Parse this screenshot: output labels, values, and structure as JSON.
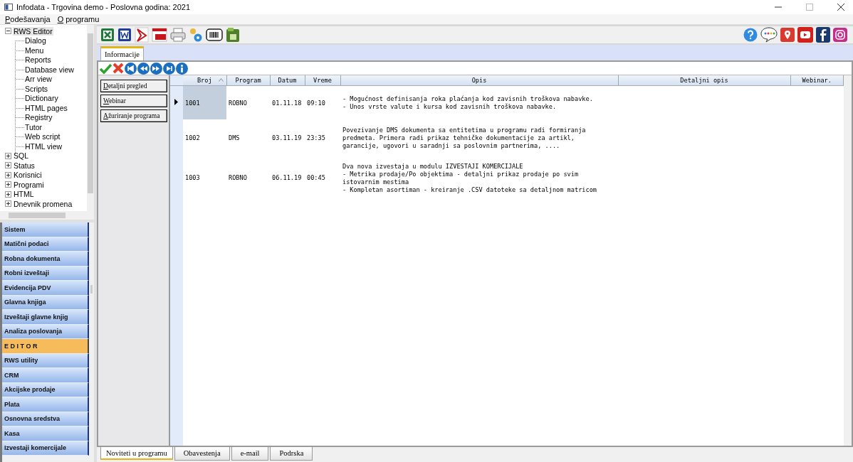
{
  "window": {
    "title": "Infodata -  Trgovina demo - Poslovna godina: 2021"
  },
  "menu": [
    "Podešavanja",
    "O programu"
  ],
  "tree": [
    {
      "label": "RWS Editor",
      "expanded": true,
      "selected": true,
      "children": [
        {
          "label": "Dialog",
          "selected": false
        },
        {
          "label": "Menu",
          "selected": false
        },
        {
          "label": "Reports",
          "selected": false
        },
        {
          "label": "Database view",
          "selected": false
        },
        {
          "label": "Arr view",
          "selected": false
        },
        {
          "label": "Scripts",
          "selected": false
        },
        {
          "label": "Dictionary",
          "selected": false
        },
        {
          "label": "HTML pages",
          "selected": false
        },
        {
          "label": "Registry",
          "selected": false
        },
        {
          "label": "Tutor",
          "selected": false
        },
        {
          "label": "Web script",
          "selected": false
        },
        {
          "label": "HTML view",
          "selected": false
        }
      ]
    },
    {
      "label": "SQL",
      "expanded": false,
      "selected": false
    },
    {
      "label": "Status",
      "expanded": false,
      "selected": false
    },
    {
      "label": "Korisnici",
      "expanded": false,
      "selected": false
    },
    {
      "label": "Programi",
      "expanded": false,
      "selected": false
    },
    {
      "label": "HTML",
      "expanded": false,
      "selected": false
    },
    {
      "label": "Dnevnik promena",
      "expanded": false,
      "selected": false
    }
  ],
  "modules": [
    {
      "label": "Sistem",
      "selected": false
    },
    {
      "label": "Matični podaci",
      "selected": false
    },
    {
      "label": "Robna dokumenta",
      "selected": false
    },
    {
      "label": "Robni izveštaji",
      "selected": false
    },
    {
      "label": "Evidencija PDV",
      "selected": false
    },
    {
      "label": "Glavna knjiga",
      "selected": false
    },
    {
      "label": "Izveštaji glavne knjig",
      "selected": false
    },
    {
      "label": "Analiza poslovanja",
      "selected": false
    },
    {
      "label": "E D I T O R",
      "selected": true
    },
    {
      "label": "RWS utility",
      "selected": false
    },
    {
      "label": "CRM",
      "selected": false
    },
    {
      "label": "Akcijske prodaje",
      "selected": false
    },
    {
      "label": "Plata",
      "selected": false
    },
    {
      "label": "Osnovna sredstva",
      "selected": false
    },
    {
      "label": "Kasa",
      "selected": false
    },
    {
      "label": "Izvestaji komercijale",
      "selected": false
    }
  ],
  "doc_tabs": [
    {
      "label": "Informacije",
      "selected": true
    }
  ],
  "side_buttons": [
    "Detaljni pregled",
    "Webinar",
    "Ažuriranje programa"
  ],
  "table": {
    "columns": [
      {
        "label": "Broj",
        "sorted": true
      },
      {
        "label": "Program",
        "sorted": false
      },
      {
        "label": "Datum",
        "sorted": false
      },
      {
        "label": "Vreme",
        "sorted": false
      },
      {
        "label": "Opis",
        "sorted": false
      },
      {
        "label": "Detaljni opis",
        "sorted": false
      },
      {
        "label": "Webinar.",
        "sorted": false
      }
    ],
    "rows": [
      {
        "broj": "1001",
        "program": "ROBNO",
        "datum": "01.11.18",
        "vreme": "09:10",
        "opis": "- Mogućnost definisanja roka plaćanja kod zavisnih troškova nabavke.\n- Unos vrste valute i kursa kod zavisnih troškova nabavke.",
        "selected": true
      },
      {
        "broj": "1002",
        "program": "DMS",
        "datum": "03.11.19",
        "vreme": "23:35",
        "opis": "Povezivanje DMS dokumenta sa entitetima u programu radi formiranja\npredmeta. Primera radi prikaz tehničke dokumentacije za artikl,\ngarancije, ugovori u saradnji sa poslovnim partnerima, ....",
        "selected": false
      },
      {
        "broj": "1003",
        "program": "ROBNO",
        "datum": "06.11.19",
        "vreme": "00:45",
        "opis": "Dva nova izvestaja u modulu IZVESTAJI KOMERCIJALE\n- Metrika prodaje/Po objektima - detaljni prikaz prodaje po svim\nistovarnim mestima\n- Kompletan asortiman - kreiranje .CSV datoteke sa detaljnom matricom",
        "selected": false
      }
    ]
  },
  "bottom_tabs": [
    {
      "label": "Noviteti u programu",
      "selected": true
    },
    {
      "label": "Obavestenja",
      "selected": false
    },
    {
      "label": "e-mail",
      "selected": false
    },
    {
      "label": "Podrska",
      "selected": false
    }
  ]
}
